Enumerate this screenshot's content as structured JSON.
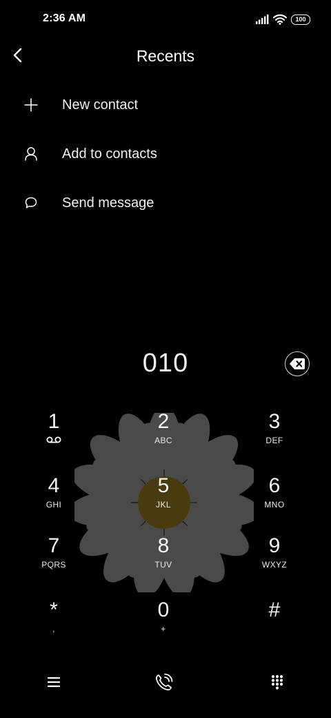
{
  "status_bar": {
    "time": "2:36 AM",
    "battery": "100",
    "signal_icon": "signal-bars-icon",
    "wifi_icon": "wifi-icon"
  },
  "header": {
    "title": "Recents",
    "back_icon": "chevron-left-icon"
  },
  "menu": {
    "items": [
      {
        "label": "New contact",
        "icon": "plus-icon"
      },
      {
        "label": "Add to contacts",
        "icon": "person-icon"
      },
      {
        "label": "Send message",
        "icon": "speech-bubble-icon"
      }
    ]
  },
  "dialer": {
    "number": "010",
    "backspace_icon": "backspace-icon"
  },
  "keypad": {
    "keys": [
      {
        "digit": "1",
        "letters": ""
      },
      {
        "digit": "2",
        "letters": "ABC"
      },
      {
        "digit": "3",
        "letters": "DEF"
      },
      {
        "digit": "4",
        "letters": "GHI"
      },
      {
        "digit": "5",
        "letters": "JKL"
      },
      {
        "digit": "6",
        "letters": "MNO"
      },
      {
        "digit": "7",
        "letters": "PQRS"
      },
      {
        "digit": "8",
        "letters": "TUV"
      },
      {
        "digit": "9",
        "letters": "WXYZ"
      },
      {
        "digit": "*",
        "letters": ","
      },
      {
        "digit": "0",
        "letters": "+"
      },
      {
        "digit": "#",
        "letters": ""
      }
    ]
  },
  "bottom_bar": {
    "menu_icon": "hamburger-menu-icon",
    "call_icon": "phone-call-icon",
    "keypad_icon": "dialpad-icon"
  },
  "colors": {
    "background": "#000000",
    "text": "#ffffff",
    "flower_petal": "#4a4a4a",
    "flower_center": "#4a3a10"
  }
}
